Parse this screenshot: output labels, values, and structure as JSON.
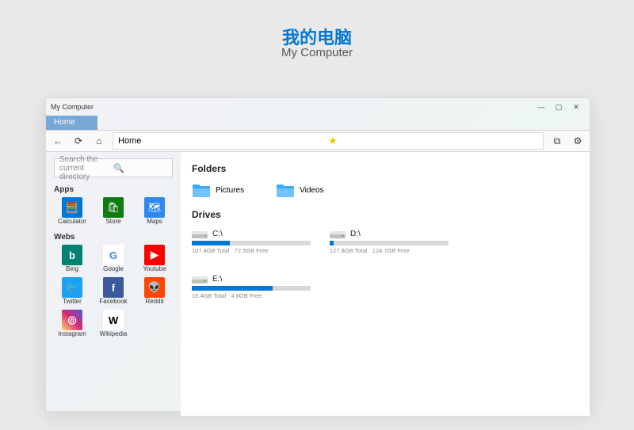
{
  "page": {
    "title_cn": "我的电脑",
    "title_en": "My Computer"
  },
  "window": {
    "title": "My Computer",
    "tab": "Home",
    "nav": {
      "path": "Home"
    },
    "search": {
      "placeholder": "Search the current directory"
    },
    "sidebar": {
      "apps_label": "Apps",
      "webs_label": "Webs",
      "apps": [
        {
          "name": "Calculator",
          "bg": "#0078d7",
          "glyph": "🧮"
        },
        {
          "name": "Store",
          "bg": "#107c10",
          "glyph": "🛍"
        },
        {
          "name": "Maps",
          "bg": "#2d89ef",
          "glyph": "🗺"
        }
      ],
      "webs": [
        {
          "name": "Bing",
          "bg": "#008373",
          "glyph": "b"
        },
        {
          "name": "Google",
          "bg": "#ffffff",
          "glyph": "G",
          "fg": "#4285f4"
        },
        {
          "name": "Youtube",
          "bg": "#ff0000",
          "glyph": "▶"
        },
        {
          "name": "Twitter",
          "bg": "#1da1f2",
          "glyph": "🐦"
        },
        {
          "name": "Facebook",
          "bg": "#3b5998",
          "glyph": "f"
        },
        {
          "name": "Reddit",
          "bg": "#ff4500",
          "glyph": "👽"
        },
        {
          "name": "Instagram",
          "bg": "linear-gradient(45deg,#feda75,#d62976,#4f5bd5)",
          "glyph": "◎"
        },
        {
          "name": "Wikipedia",
          "bg": "#ffffff",
          "glyph": "W",
          "fg": "#000"
        }
      ]
    },
    "main": {
      "folders_label": "Folders",
      "drives_label": "Drives",
      "folders": [
        {
          "name": "Pictures"
        },
        {
          "name": "Videos"
        }
      ],
      "drives": [
        {
          "label": "C:\\",
          "total": "107.4GB Total",
          "free": "72.5GB Free",
          "fill": 32
        },
        {
          "label": "D:\\",
          "total": "127.8GB Total",
          "free": "124.7GB Free",
          "fill": 3
        },
        {
          "label": "E:\\",
          "total": "15.4GB Total",
          "free": "4.8GB Free",
          "fill": 68
        }
      ]
    }
  }
}
